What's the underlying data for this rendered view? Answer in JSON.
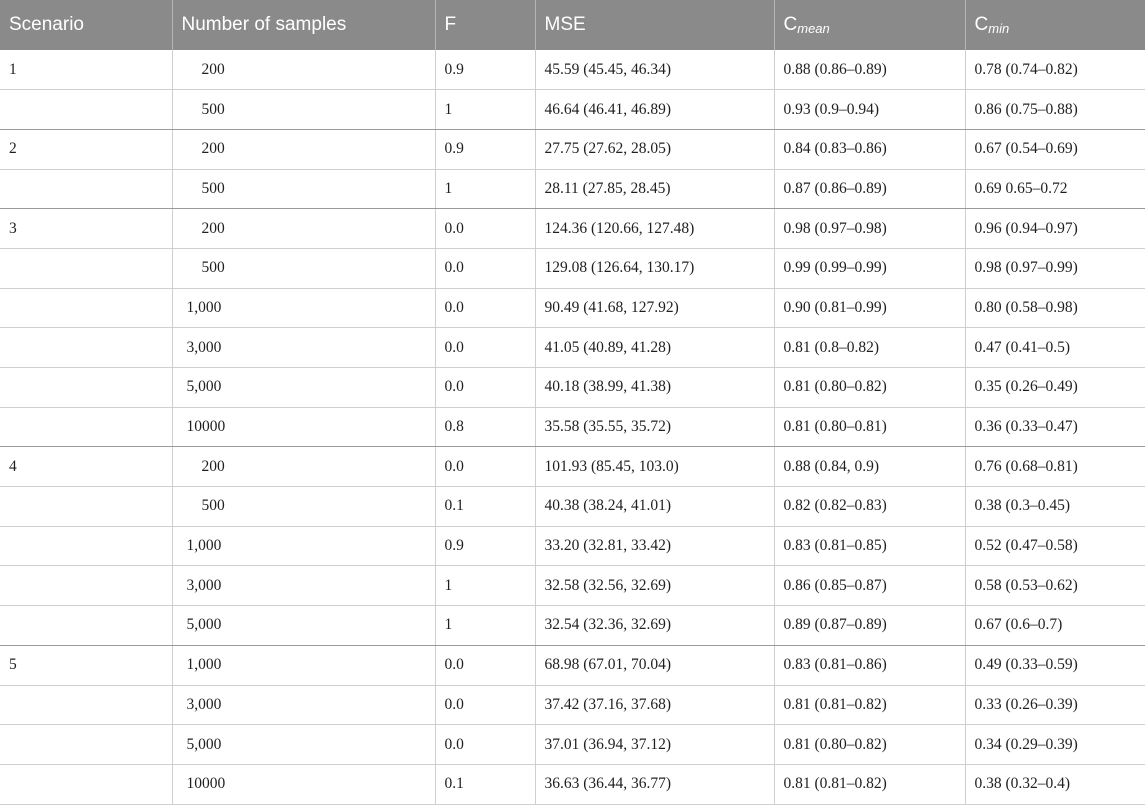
{
  "table": {
    "headers": {
      "scenario": "Scenario",
      "samples": "Number of samples",
      "f": "F",
      "mse": "MSE",
      "cmean_base": "C",
      "cmean_sub": "mean",
      "cmin_base": "C",
      "cmin_sub": "min"
    },
    "rows": [
      {
        "scenario": "1",
        "samples": "200",
        "f": "0.9",
        "mse": "45.59 (45.45, 46.34)",
        "cmean": "0.88 (0.86–0.89)",
        "cmin": "0.78 (0.74–0.82)"
      },
      {
        "scenario": "",
        "samples": "500",
        "f": "1",
        "mse": "46.64 (46.41, 46.89)",
        "cmean": "0.93 (0.9–0.94)",
        "cmin": "0.86 (0.75–0.88)"
      },
      {
        "scenario": "2",
        "samples": "200",
        "f": "0.9",
        "mse": "27.75 (27.62, 28.05)",
        "cmean": "0.84 (0.83–0.86)",
        "cmin": "0.67 (0.54–0.69)"
      },
      {
        "scenario": "",
        "samples": "500",
        "f": "1",
        "mse": "28.11 (27.85, 28.45)",
        "cmean": "0.87 (0.86–0.89)",
        "cmin": "0.69 0.65–0.72"
      },
      {
        "scenario": "3",
        "samples": "200",
        "f": "0.0",
        "mse": "124.36 (120.66, 127.48)",
        "cmean": "0.98 (0.97–0.98)",
        "cmin": "0.96 (0.94–0.97)"
      },
      {
        "scenario": "",
        "samples": "500",
        "f": "0.0",
        "mse": "129.08 (126.64, 130.17)",
        "cmean": "0.99 (0.99–0.99)",
        "cmin": "0.98 (0.97–0.99)"
      },
      {
        "scenario": "",
        "samples": "1,000",
        "f": "0.0",
        "mse": "90.49 (41.68, 127.92)",
        "cmean": "0.90 (0.81–0.99)",
        "cmin": "0.80 (0.58–0.98)"
      },
      {
        "scenario": "",
        "samples": "3,000",
        "f": "0.0",
        "mse": "41.05 (40.89, 41.28)",
        "cmean": "0.81 (0.8–0.82)",
        "cmin": "0.47 (0.41–0.5)"
      },
      {
        "scenario": "",
        "samples": "5,000",
        "f": "0.0",
        "mse": "40.18 (38.99, 41.38)",
        "cmean": "0.81 (0.80–0.82)",
        "cmin": "0.35 (0.26–0.49)"
      },
      {
        "scenario": "",
        "samples": "10000",
        "f": "0.8",
        "mse": "35.58 (35.55, 35.72)",
        "cmean": "0.81 (0.80–0.81)",
        "cmin": "0.36 (0.33–0.47)"
      },
      {
        "scenario": "4",
        "samples": "200",
        "f": "0.0",
        "mse": "101.93 (85.45, 103.0)",
        "cmean": "0.88 (0.84, 0.9)",
        "cmin": "0.76 (0.68–0.81)"
      },
      {
        "scenario": "",
        "samples": "500",
        "f": "0.1",
        "mse": "40.38 (38.24, 41.01)",
        "cmean": "0.82 (0.82–0.83)",
        "cmin": "0.38 (0.3–0.45)"
      },
      {
        "scenario": "",
        "samples": "1,000",
        "f": "0.9",
        "mse": "33.20 (32.81, 33.42)",
        "cmean": "0.83 (0.81–0.85)",
        "cmin": "0.52 (0.47–0.58)"
      },
      {
        "scenario": "",
        "samples": "3,000",
        "f": "1",
        "mse": "32.58 (32.56, 32.69)",
        "cmean": "0.86 (0.85–0.87)",
        "cmin": "0.58 (0.53–0.62)"
      },
      {
        "scenario": "",
        "samples": "5,000",
        "f": "1",
        "mse": "32.54 (32.36, 32.69)",
        "cmean": "0.89 (0.87–0.89)",
        "cmin": "0.67 (0.6–0.7)"
      },
      {
        "scenario": "5",
        "samples": "1,000",
        "f": "0.0",
        "mse": "68.98 (67.01, 70.04)",
        "cmean": "0.83 (0.81–0.86)",
        "cmin": "0.49 (0.33–0.59)"
      },
      {
        "scenario": "",
        "samples": "3,000",
        "f": "0.0",
        "mse": "37.42 (37.16, 37.68)",
        "cmean": "0.81 (0.81–0.82)",
        "cmin": "0.33 (0.26–0.39)"
      },
      {
        "scenario": "",
        "samples": "5,000",
        "f": "0.0",
        "mse": "37.01 (36.94, 37.12)",
        "cmean": "0.81 (0.80–0.82)",
        "cmin": "0.34 (0.29–0.39)"
      },
      {
        "scenario": "",
        "samples": "10000",
        "f": "0.1",
        "mse": "36.63 (36.44, 36.77)",
        "cmean": "0.81 (0.81–0.82)",
        "cmin": "0.38 (0.32–0.4)"
      }
    ]
  }
}
